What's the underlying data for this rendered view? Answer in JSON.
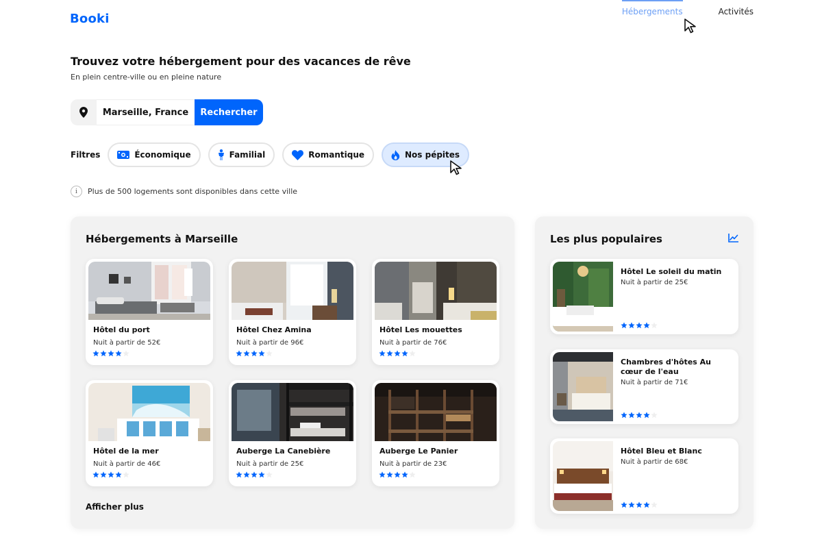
{
  "header": {
    "logo": "Booki",
    "nav": [
      "Hébergements",
      "Activités"
    ]
  },
  "hero": {
    "title": "Trouvez votre hébergement pour des vacances de rêve",
    "subtitle": "En plein centre-ville ou en pleine nature"
  },
  "search": {
    "location": "Marseille, France",
    "button": "Rechercher",
    "pin_icon": "location-pin-icon"
  },
  "filters": {
    "label": "Filtres",
    "items": [
      {
        "label": "Économique",
        "icon": "money-icon",
        "active": false
      },
      {
        "label": "Familial",
        "icon": "child-icon",
        "active": false
      },
      {
        "label": "Romantique",
        "icon": "heart-icon",
        "active": false
      },
      {
        "label": "Nos pépites",
        "icon": "fire-icon",
        "active": true
      }
    ]
  },
  "info": {
    "icon": "info-icon",
    "text": "Plus de 500 logements sont disponibles dans cette ville"
  },
  "listings": {
    "title": "Hébergements à Marseille",
    "more": "Afficher plus",
    "cards": [
      {
        "name": "Hôtel du port",
        "price": "Nuit à partir de 52€",
        "rating": 4
      },
      {
        "name": "Hôtel Chez Amina",
        "price": "Nuit à partir de 96€",
        "rating": 4
      },
      {
        "name": "Hôtel Les mouettes",
        "price": "Nuit à partir de 76€",
        "rating": 4
      },
      {
        "name": "Hôtel de la mer",
        "price": "Nuit à partir de 46€",
        "rating": 4
      },
      {
        "name": "Auberge La Canebière",
        "price": "Nuit à partir de 25€",
        "rating": 4
      },
      {
        "name": "Auberge Le Panier",
        "price": "Nuit à partir de 23€",
        "rating": 4
      }
    ]
  },
  "popular": {
    "title": "Les plus populaires",
    "icon": "trend-chart-icon",
    "cards": [
      {
        "name": "Hôtel Le soleil du matin",
        "price": "Nuit à partir de 25€",
        "rating": 4
      },
      {
        "name": "Chambres d'hôtes Au cœur de l'eau",
        "price": "Nuit à partir de 71€",
        "rating": 4
      },
      {
        "name": "Hôtel Bleu et Blanc",
        "price": "Nuit à partir de 68€",
        "rating": 4
      }
    ]
  },
  "colors": {
    "accent": "#0065FC",
    "active_chip": "#DEEBFF",
    "panel": "#F2F2F2"
  }
}
